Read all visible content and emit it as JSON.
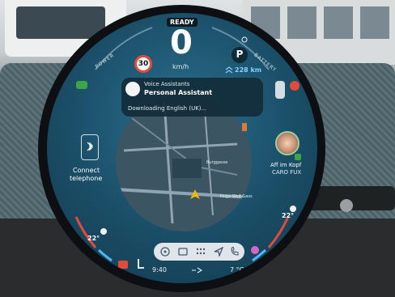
{
  "status": {
    "ready_label": "READY",
    "speed": "0",
    "speed_unit": "km/h",
    "speed_limit": "30",
    "gear": "P",
    "range": "228 km",
    "power_label": "POWER",
    "battery_label": "BATTERY"
  },
  "voice_assistant": {
    "title": "Voice Assistants",
    "subtitle": "Personal Assistant",
    "download_text": "Downloading English (UK)..."
  },
  "left_widget": {
    "label_line1": "Connect",
    "label_line2": "telephone",
    "icon": "bluetooth-icon"
  },
  "media": {
    "title": "Aff im Kopf",
    "artist": "CARO FUX"
  },
  "map": {
    "street1": "Burggasse",
    "street2": "Hugo-Wolf-Gass"
  },
  "climate": {
    "left_temp": "22°",
    "right_temp": "22°"
  },
  "bottom_bar": {
    "time": "9:40",
    "outside_temp": "7 °C",
    "icons": [
      "fan-icon",
      "media-icon",
      "apps-icon",
      "navigation-icon",
      "phone-icon"
    ]
  },
  "colors": {
    "screen_bg": "#1a4d66",
    "accent_red": "#e24b3b",
    "accent_green": "#3fa34a",
    "range_blue": "#7fd2ff"
  }
}
